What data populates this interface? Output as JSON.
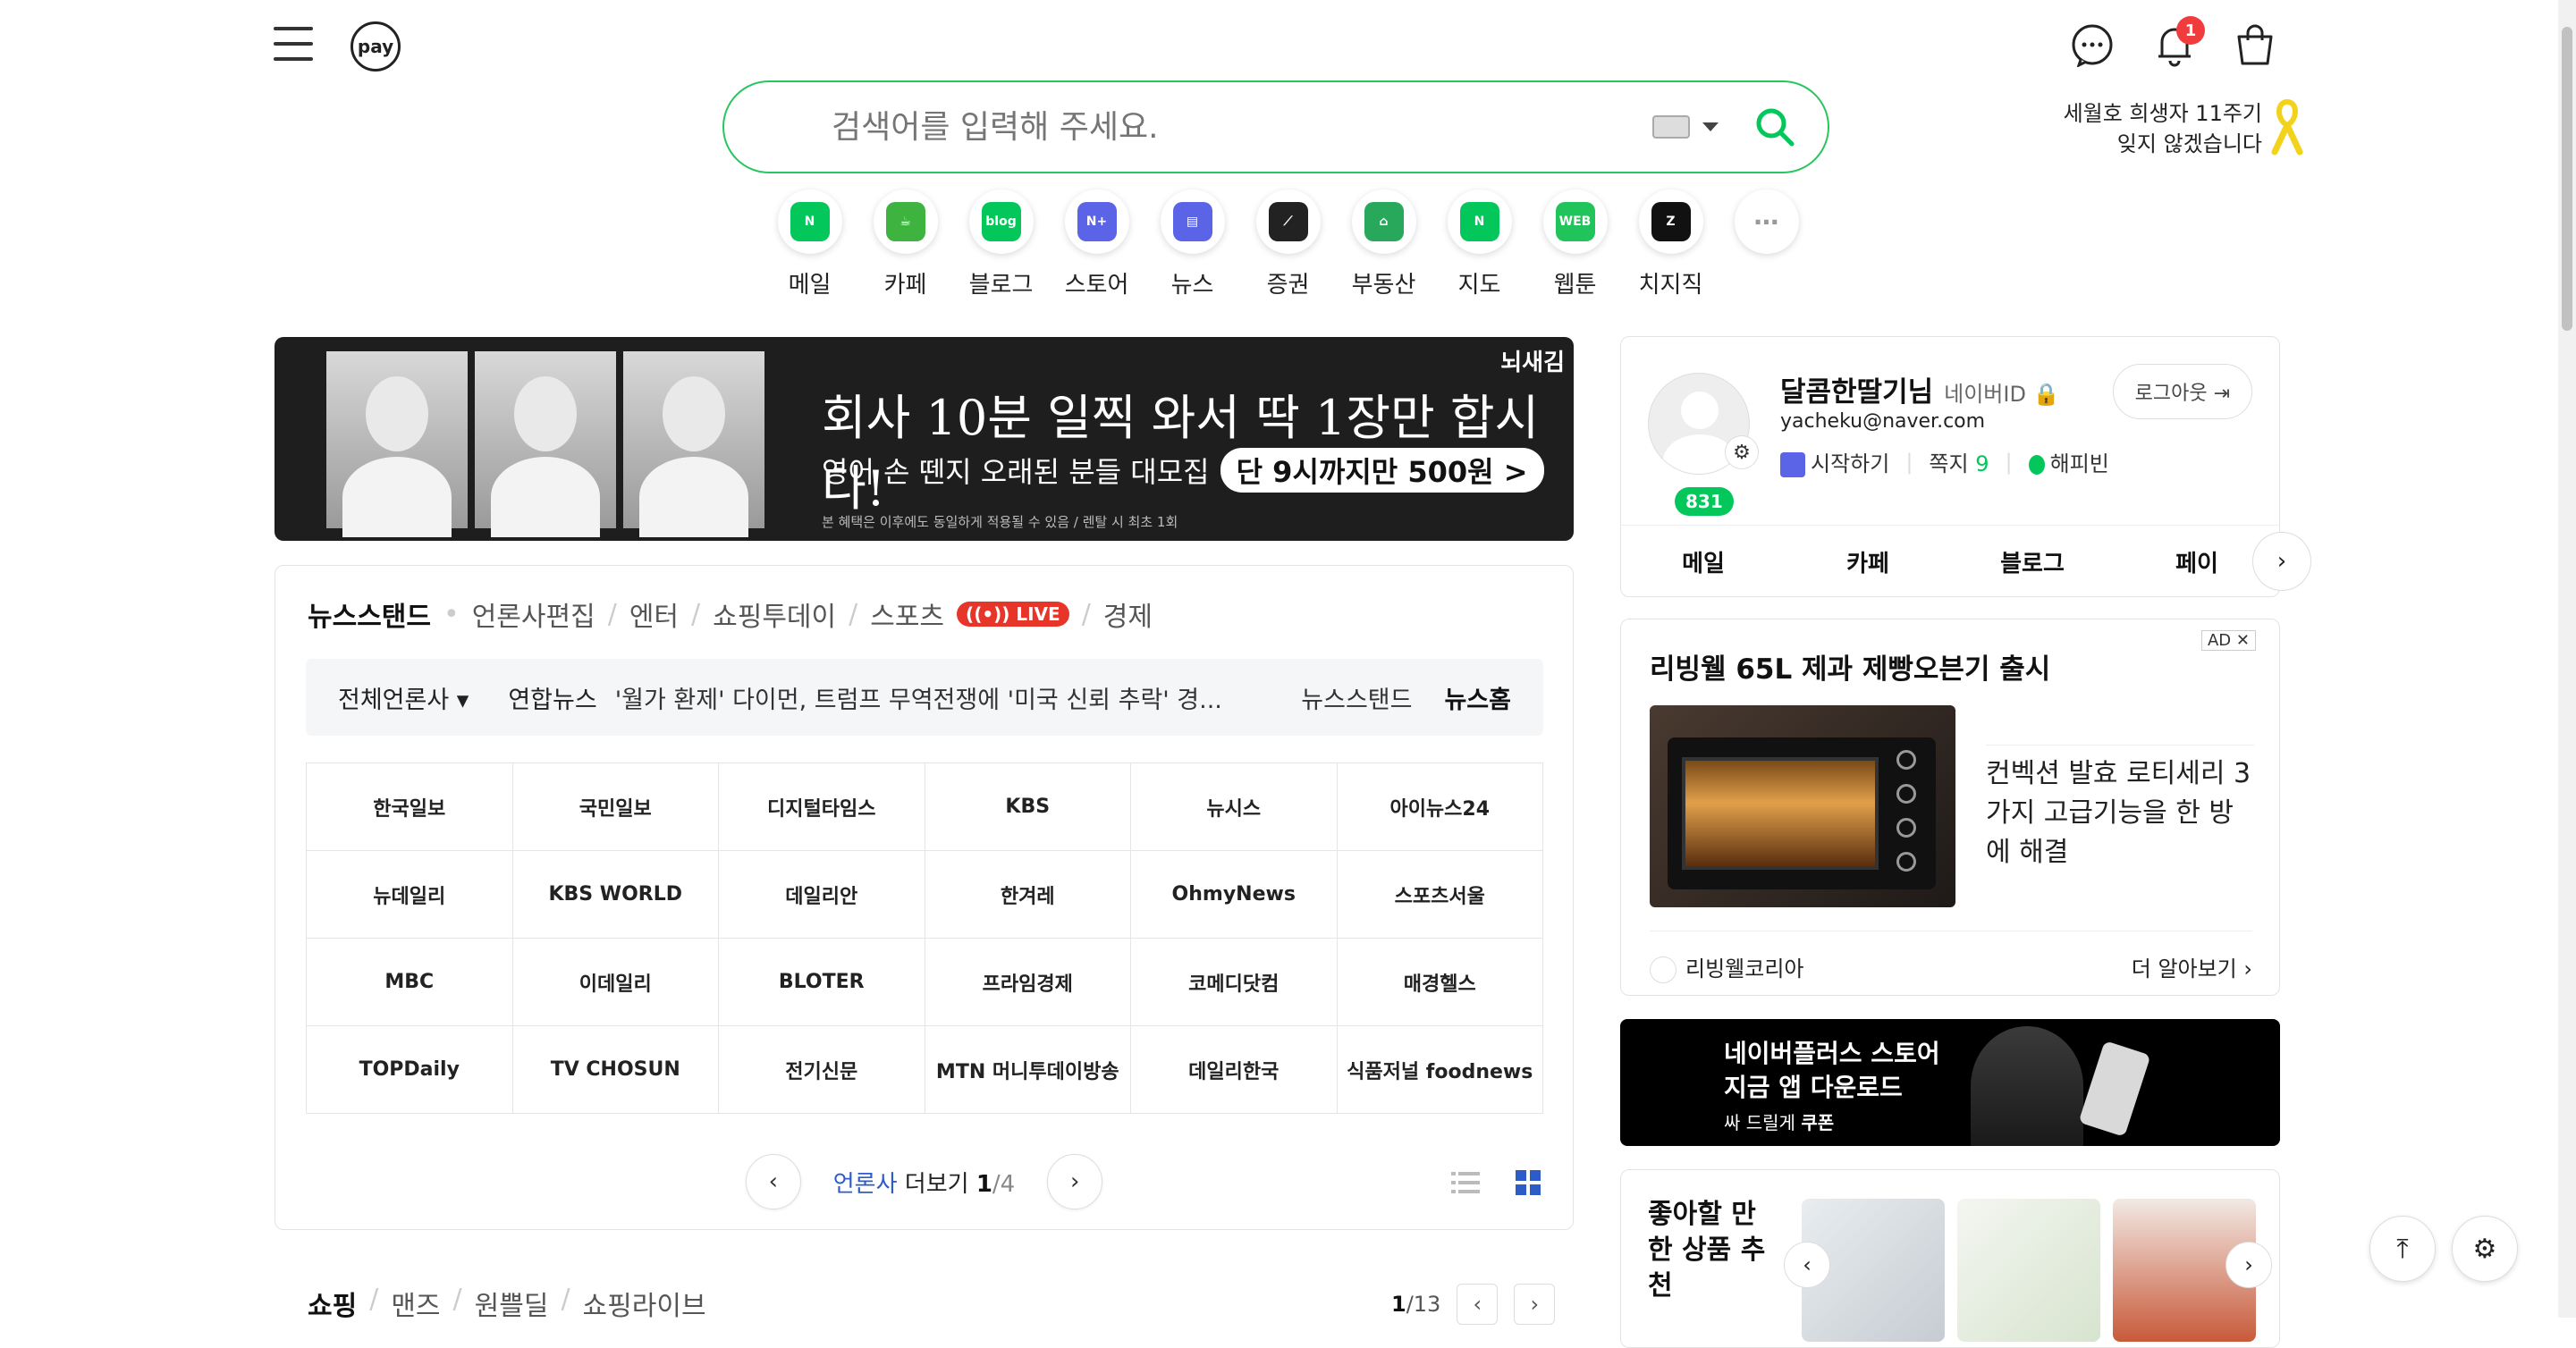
{
  "header": {
    "pay_logo": "pay",
    "notification_count": "1",
    "search_placeholder": "검색어를 입력해 주세요.",
    "memorial_line1": "세월호 희생자 11주기",
    "memorial_line2": "잊지 않겠습니다"
  },
  "shortcuts": [
    {
      "label": "메일",
      "icon": "mail-icon",
      "color": "#03c75a",
      "glyph": "N"
    },
    {
      "label": "카페",
      "icon": "cafe-icon",
      "color": "#3fb33f",
      "glyph": "☕"
    },
    {
      "label": "블로그",
      "icon": "blog-icon",
      "color": "#03c75a",
      "glyph": "blog"
    },
    {
      "label": "스토어",
      "icon": "store-icon",
      "color": "#5b63e6",
      "glyph": "N+"
    },
    {
      "label": "뉴스",
      "icon": "news-icon",
      "color": "#5b63e6",
      "glyph": "▤"
    },
    {
      "label": "증권",
      "icon": "stock-icon",
      "color": "#222222",
      "glyph": "⟋"
    },
    {
      "label": "부동산",
      "icon": "realestate-icon",
      "color": "#27a85a",
      "glyph": "⌂"
    },
    {
      "label": "지도",
      "icon": "map-icon",
      "color": "#03c75a",
      "glyph": "N"
    },
    {
      "label": "웹툰",
      "icon": "webtoon-icon",
      "color": "#21c45a",
      "glyph": "WEB"
    },
    {
      "label": "치지직",
      "icon": "chzzk-icon",
      "color": "#111111",
      "glyph": "Z"
    }
  ],
  "banner": {
    "brand": "뇌새김",
    "headline": "회사 10분 일찍 와서 딱 1장만 합시다!",
    "subline": "영어 손 뗀지 오래된 분들 대모집",
    "cta": "단 9시까지만 500원 >",
    "fineprint": "본 혜택은 이후에도 동일하게 적용될 수 있음 / 렌탈 시 최초 1회"
  },
  "newsstand": {
    "tabs": [
      "뉴스스탠드",
      "언론사편집",
      "엔터",
      "쇼핑투데이",
      "스포츠",
      "경제"
    ],
    "live": "LIVE",
    "filter": "전체언론사",
    "source": "연합뉴스",
    "headline": "'월가 환제' 다이먼, 트럼프 무역전쟁에 '미국 신뢰 추락' 경...",
    "right_link1": "뉴스스탠드",
    "right_link2": "뉴스홈",
    "publishers": [
      "한국일보",
      "국민일보",
      "디지털타임스",
      "KBS",
      "뉴시스",
      "아이뉴스24",
      "뉴데일리",
      "KBS WORLD",
      "데일리안",
      "한겨레",
      "OhmyNews",
      "스포츠서울",
      "MBC",
      "이데일리",
      "BLOTER",
      "프라임경제",
      "코메디닷컴",
      "매경헬스",
      "TOPDaily",
      "TV CHOSUN",
      "전기신문",
      "MTN 머니투데이방송",
      "데일리한국",
      "식품저널 foodnews"
    ],
    "more_label": "언론사",
    "more_suffix": "더보기",
    "page": "1",
    "page_total": "/4"
  },
  "shopping": {
    "tabs": [
      "쇼핑",
      "맨즈",
      "원쁠딜",
      "쇼핑라이브"
    ],
    "page": "1",
    "page_total": "/13"
  },
  "profile": {
    "name": "달콤한딸기님",
    "id_label": "네이버ID",
    "email": "yacheku@naver.com",
    "start": "시작하기",
    "note_label": "쪽지",
    "note_count": "9",
    "happybean": "해피빈",
    "logout": "로그아웃",
    "mail_count": "831",
    "links": [
      "메일",
      "카페",
      "블로그",
      "페이"
    ]
  },
  "ad": {
    "title": "리빙웰 65L 제과 제빵오븐기 출시",
    "tag": "AD",
    "description": "컨벡션 발효 로티세리 3가지 고급기능을 한 방에 해결",
    "advertiser": "리빙웰코리아",
    "more": "더 알아보기"
  },
  "plus_banner": {
    "line1": "네이버플러스 스토어",
    "line2": "지금 앱 다운로드",
    "line3_prefix": "싸 드릴게",
    "line3_bold": "쿠폰"
  },
  "recommend": {
    "title": "좋아할 만한 상품 추천"
  }
}
